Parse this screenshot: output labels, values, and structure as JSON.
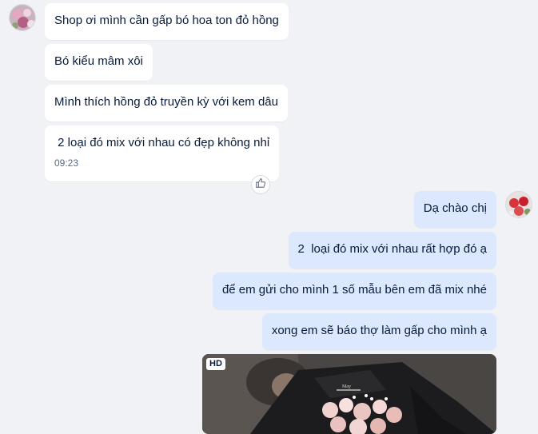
{
  "incoming": [
    {
      "text": "Shop ơi mình cần gấp bó hoa ton đỏ hồng"
    },
    {
      "text": "Bó kiểu mâm xôi"
    },
    {
      "text": "Mình thích hồng đỏ truyền kỳ với kem dâu"
    },
    {
      "text": " 2 loại đó mix với nhau có đẹp không nhỉ",
      "time": "09:23"
    }
  ],
  "outgoing": [
    {
      "text": "Dạ chào chị"
    },
    {
      "text": "2  loại đó mix với nhau rất hợp đó ạ"
    },
    {
      "text": "để em gửi cho mình 1 số mẫu bên em đã mix nhé"
    },
    {
      "text": "xong em sẽ báo thợ làm gấp cho mình ạ"
    }
  ],
  "image_message": {
    "badge": "HD",
    "icon": "flower-bouquet-photo"
  },
  "reaction": {
    "icon": "thumbs-up-icon"
  },
  "colors": {
    "background": "#f0f2f5",
    "incoming_bubble": "#ffffff",
    "outgoing_bubble": "#dbe8fd",
    "text": "#081b3a"
  }
}
